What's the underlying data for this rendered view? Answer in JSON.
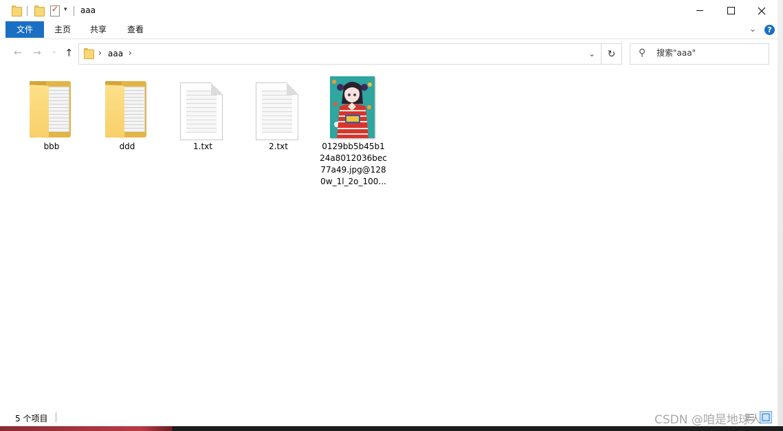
{
  "window": {
    "title": "aaa",
    "quick_access_dropdown": "▾"
  },
  "ribbon": {
    "tabs": [
      {
        "label": "文件",
        "active": true
      },
      {
        "label": "主页",
        "active": false
      },
      {
        "label": "共享",
        "active": false
      },
      {
        "label": "查看",
        "active": false
      }
    ],
    "expand_glyph": "⌄",
    "help_glyph": "?"
  },
  "address_bar": {
    "back_glyph": "←",
    "forward_glyph": "→",
    "recent_glyph": "⌄",
    "up_glyph": "↑",
    "crumbs": [
      "aaa"
    ],
    "chevron": "›",
    "dropdown_glyph": "⌄",
    "refresh_glyph": "↻"
  },
  "search": {
    "placeholder": "搜索\"aaa\"",
    "icon": "search-icon"
  },
  "files": [
    {
      "name": "bbb",
      "type": "folder"
    },
    {
      "name": "ddd",
      "type": "folder"
    },
    {
      "name": "1.txt",
      "type": "text"
    },
    {
      "name": "2.txt",
      "type": "text"
    },
    {
      "name_lines": [
        "0129bb5b45b1",
        "24a8012036bec",
        "77a49.jpg@128",
        "0w_1l_2o_100..."
      ],
      "type": "image"
    }
  ],
  "status": {
    "item_count": "5 个项目"
  },
  "watermark": "CSDN @咱是地球人",
  "colors": {
    "accent": "#1a6fc3",
    "folder": "#f8d06a"
  }
}
